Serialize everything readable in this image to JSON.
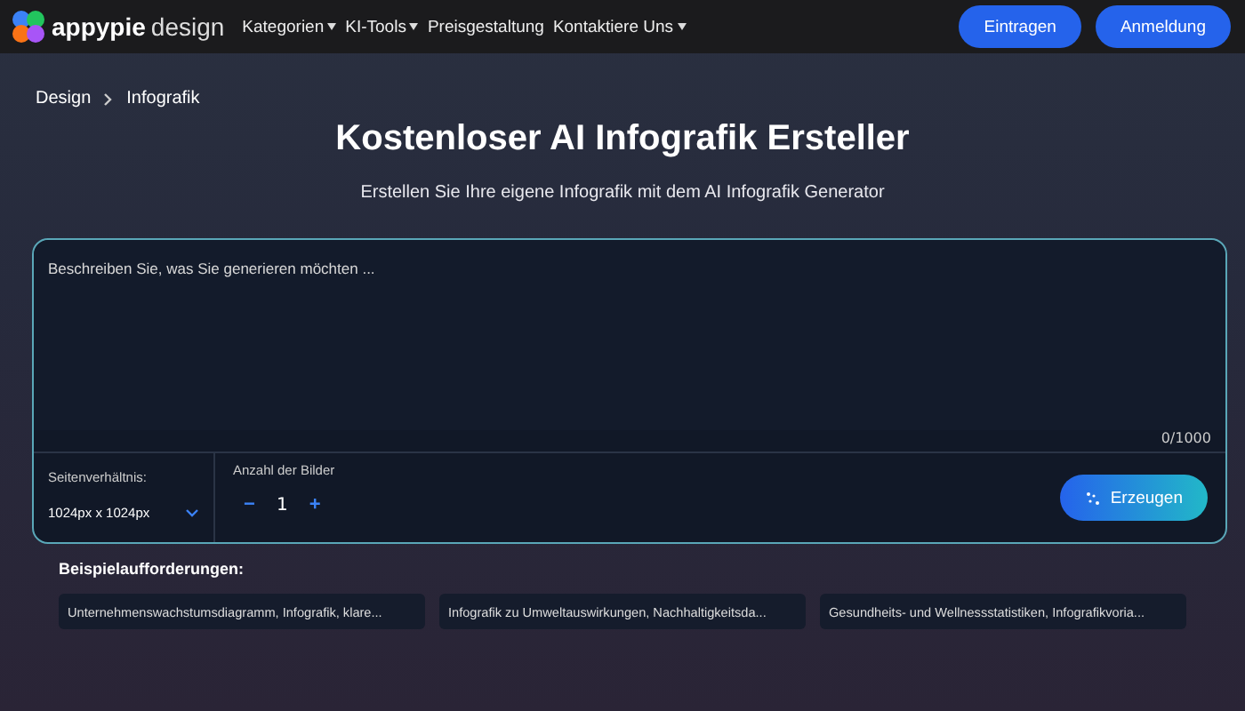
{
  "nav": {
    "logo_text": "appypie",
    "logo_suffix": "design",
    "menu": [
      {
        "label": "Kategorien",
        "dropdown": true
      },
      {
        "label": "KI-Tools",
        "dropdown": true
      },
      {
        "label": "Preisgestaltung",
        "dropdown": false
      },
      {
        "label": "Kontaktiere Uns",
        "dropdown": true
      }
    ],
    "buttons": [
      "Eintragen",
      "Anmeldung"
    ]
  },
  "breadcrumb": [
    "Design",
    "Infografik"
  ],
  "title": "Kostenloser AI Infografik Ersteller",
  "subtitle": "Erstellen Sie Ihre eigene Infografik mit dem AI Infografik Generator",
  "prompt": {
    "placeholder": "Beschreiben Sie, was Sie generieren möchten ...",
    "counter": "0/1000",
    "aspect_label": "Seitenverhältnis:",
    "aspect_value": "1024px x 1024px",
    "count_label": "Anzahl der Bilder",
    "minus": "−",
    "count": "1",
    "plus": "+",
    "generate": "Erzeugen"
  },
  "examples": {
    "label": "Beispielaufforderungen:",
    "items": [
      "Unternehmenswachstumsdiagramm, Infografik, klare...",
      "Infografik zu Umweltauswirkungen, Nachhaltigkeitsda...",
      "Gesundheits- und Wellnessstatistiken, Infografikvoria..."
    ]
  }
}
